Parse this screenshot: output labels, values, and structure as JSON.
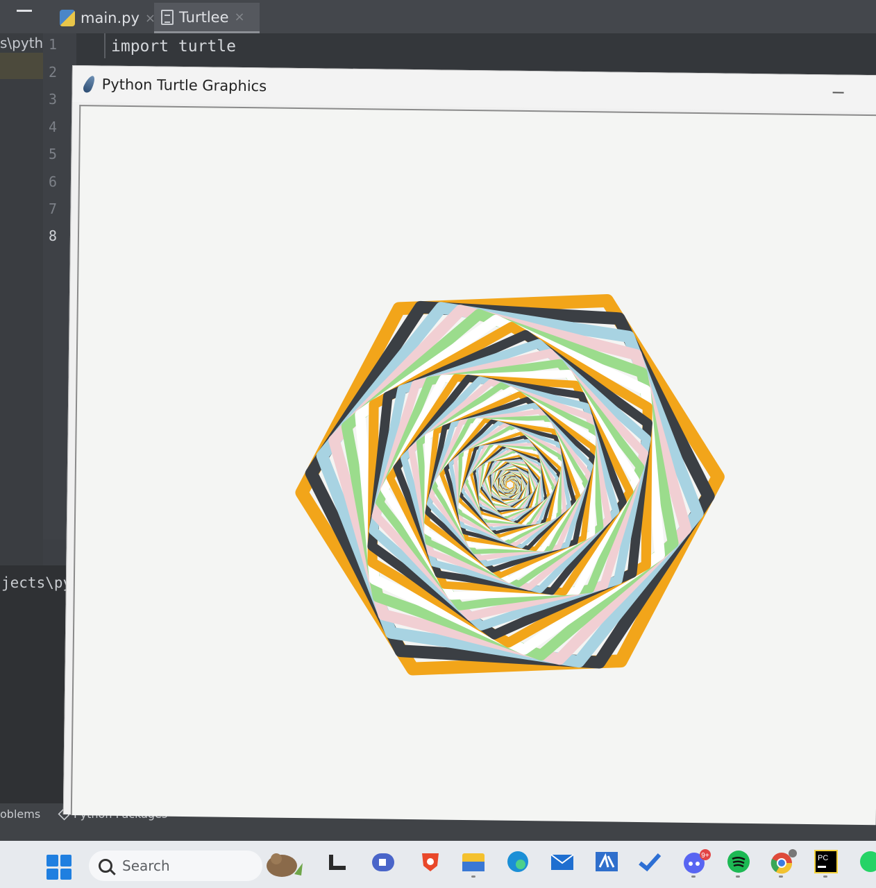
{
  "ide": {
    "tabs": [
      {
        "label": "main.py",
        "close": "×"
      },
      {
        "label": "Turtlee",
        "close": "×"
      }
    ],
    "project_path_fragment": "s\\pytho",
    "line_numbers": [
      "1",
      "2",
      "3",
      "4",
      "5",
      "6",
      "7",
      "8"
    ],
    "code_line_1": "import turtle",
    "run_output_path": "jects\\pytho",
    "bottom_tools": [
      "oblems",
      "Python Packages"
    ]
  },
  "turtle_window": {
    "title": "Python Turtle Graphics",
    "drawing": {
      "shape": "hexagon-spiral",
      "palette": [
        "#f2a51a",
        "#3b3f44",
        "#a8d3e2",
        "#f1cfd3",
        "#9bdc8c",
        "#ffffff"
      ]
    }
  },
  "taskbar": {
    "search_placeholder": "Search",
    "apps": [
      "file-explorer",
      "task-view",
      "zoom",
      "brave",
      "folder",
      "edge",
      "mail",
      "teams-alt",
      "todo",
      "discord",
      "spotify",
      "chrome",
      "pycharm",
      "whatsapp"
    ],
    "discord_badge": "9+"
  }
}
